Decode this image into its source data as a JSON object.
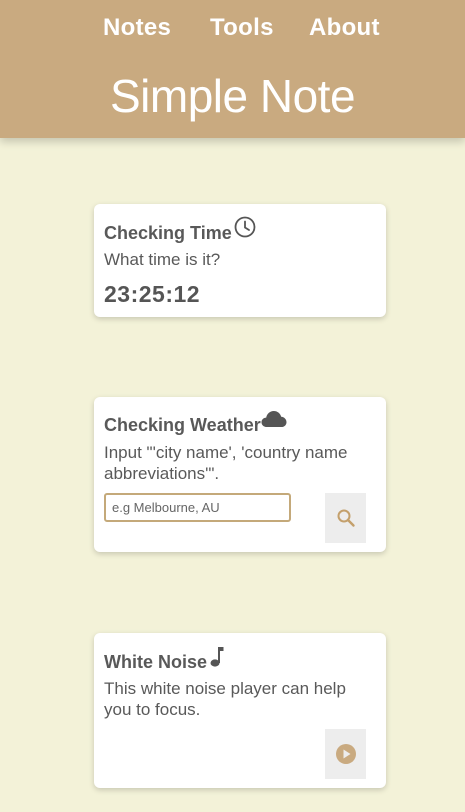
{
  "nav": {
    "items": [
      {
        "label": "Notes"
      },
      {
        "label": "Tools"
      },
      {
        "label": "About"
      }
    ]
  },
  "header": {
    "title": "Simple Note"
  },
  "time_card": {
    "title": "Checking Time",
    "question": "What time is it?",
    "clock": "23:25:12",
    "icon": "clock-icon"
  },
  "weather_card": {
    "title": "Checking Weather",
    "instruction": "Input \"'city name', 'country name abbreviations'\".",
    "input_placeholder": "e.g Melbourne, AU",
    "input_value": "",
    "icon": "cloud-icon",
    "button_icon": "search-icon"
  },
  "noise_card": {
    "title": "White Noise",
    "description": "This white noise player can help you to focus.",
    "icon": "music-note-icon",
    "button_icon": "play-icon"
  },
  "colors": {
    "header_bg": "#c9aa80",
    "page_bg": "#f3f2d8",
    "accent": "#c4a97a",
    "text": "#595959"
  }
}
